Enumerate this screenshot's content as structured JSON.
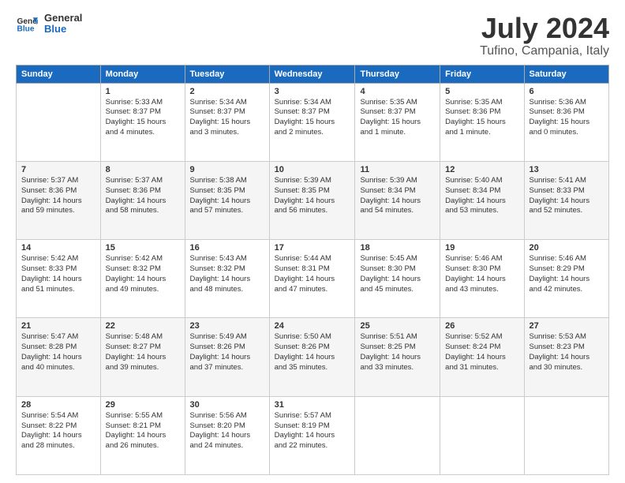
{
  "header": {
    "logo_line1": "General",
    "logo_line2": "Blue",
    "title": "July 2024",
    "subtitle": "Tufino, Campania, Italy"
  },
  "days_of_week": [
    "Sunday",
    "Monday",
    "Tuesday",
    "Wednesday",
    "Thursday",
    "Friday",
    "Saturday"
  ],
  "weeks": [
    [
      {
        "num": "",
        "info": ""
      },
      {
        "num": "1",
        "info": "Sunrise: 5:33 AM\nSunset: 8:37 PM\nDaylight: 15 hours\nand 4 minutes."
      },
      {
        "num": "2",
        "info": "Sunrise: 5:34 AM\nSunset: 8:37 PM\nDaylight: 15 hours\nand 3 minutes."
      },
      {
        "num": "3",
        "info": "Sunrise: 5:34 AM\nSunset: 8:37 PM\nDaylight: 15 hours\nand 2 minutes."
      },
      {
        "num": "4",
        "info": "Sunrise: 5:35 AM\nSunset: 8:37 PM\nDaylight: 15 hours\nand 1 minute."
      },
      {
        "num": "5",
        "info": "Sunrise: 5:35 AM\nSunset: 8:36 PM\nDaylight: 15 hours\nand 1 minute."
      },
      {
        "num": "6",
        "info": "Sunrise: 5:36 AM\nSunset: 8:36 PM\nDaylight: 15 hours\nand 0 minutes."
      }
    ],
    [
      {
        "num": "7",
        "info": "Sunrise: 5:37 AM\nSunset: 8:36 PM\nDaylight: 14 hours\nand 59 minutes."
      },
      {
        "num": "8",
        "info": "Sunrise: 5:37 AM\nSunset: 8:36 PM\nDaylight: 14 hours\nand 58 minutes."
      },
      {
        "num": "9",
        "info": "Sunrise: 5:38 AM\nSunset: 8:35 PM\nDaylight: 14 hours\nand 57 minutes."
      },
      {
        "num": "10",
        "info": "Sunrise: 5:39 AM\nSunset: 8:35 PM\nDaylight: 14 hours\nand 56 minutes."
      },
      {
        "num": "11",
        "info": "Sunrise: 5:39 AM\nSunset: 8:34 PM\nDaylight: 14 hours\nand 54 minutes."
      },
      {
        "num": "12",
        "info": "Sunrise: 5:40 AM\nSunset: 8:34 PM\nDaylight: 14 hours\nand 53 minutes."
      },
      {
        "num": "13",
        "info": "Sunrise: 5:41 AM\nSunset: 8:33 PM\nDaylight: 14 hours\nand 52 minutes."
      }
    ],
    [
      {
        "num": "14",
        "info": "Sunrise: 5:42 AM\nSunset: 8:33 PM\nDaylight: 14 hours\nand 51 minutes."
      },
      {
        "num": "15",
        "info": "Sunrise: 5:42 AM\nSunset: 8:32 PM\nDaylight: 14 hours\nand 49 minutes."
      },
      {
        "num": "16",
        "info": "Sunrise: 5:43 AM\nSunset: 8:32 PM\nDaylight: 14 hours\nand 48 minutes."
      },
      {
        "num": "17",
        "info": "Sunrise: 5:44 AM\nSunset: 8:31 PM\nDaylight: 14 hours\nand 47 minutes."
      },
      {
        "num": "18",
        "info": "Sunrise: 5:45 AM\nSunset: 8:30 PM\nDaylight: 14 hours\nand 45 minutes."
      },
      {
        "num": "19",
        "info": "Sunrise: 5:46 AM\nSunset: 8:30 PM\nDaylight: 14 hours\nand 43 minutes."
      },
      {
        "num": "20",
        "info": "Sunrise: 5:46 AM\nSunset: 8:29 PM\nDaylight: 14 hours\nand 42 minutes."
      }
    ],
    [
      {
        "num": "21",
        "info": "Sunrise: 5:47 AM\nSunset: 8:28 PM\nDaylight: 14 hours\nand 40 minutes."
      },
      {
        "num": "22",
        "info": "Sunrise: 5:48 AM\nSunset: 8:27 PM\nDaylight: 14 hours\nand 39 minutes."
      },
      {
        "num": "23",
        "info": "Sunrise: 5:49 AM\nSunset: 8:26 PM\nDaylight: 14 hours\nand 37 minutes."
      },
      {
        "num": "24",
        "info": "Sunrise: 5:50 AM\nSunset: 8:26 PM\nDaylight: 14 hours\nand 35 minutes."
      },
      {
        "num": "25",
        "info": "Sunrise: 5:51 AM\nSunset: 8:25 PM\nDaylight: 14 hours\nand 33 minutes."
      },
      {
        "num": "26",
        "info": "Sunrise: 5:52 AM\nSunset: 8:24 PM\nDaylight: 14 hours\nand 31 minutes."
      },
      {
        "num": "27",
        "info": "Sunrise: 5:53 AM\nSunset: 8:23 PM\nDaylight: 14 hours\nand 30 minutes."
      }
    ],
    [
      {
        "num": "28",
        "info": "Sunrise: 5:54 AM\nSunset: 8:22 PM\nDaylight: 14 hours\nand 28 minutes."
      },
      {
        "num": "29",
        "info": "Sunrise: 5:55 AM\nSunset: 8:21 PM\nDaylight: 14 hours\nand 26 minutes."
      },
      {
        "num": "30",
        "info": "Sunrise: 5:56 AM\nSunset: 8:20 PM\nDaylight: 14 hours\nand 24 minutes."
      },
      {
        "num": "31",
        "info": "Sunrise: 5:57 AM\nSunset: 8:19 PM\nDaylight: 14 hours\nand 22 minutes."
      },
      {
        "num": "",
        "info": ""
      },
      {
        "num": "",
        "info": ""
      },
      {
        "num": "",
        "info": ""
      }
    ]
  ]
}
